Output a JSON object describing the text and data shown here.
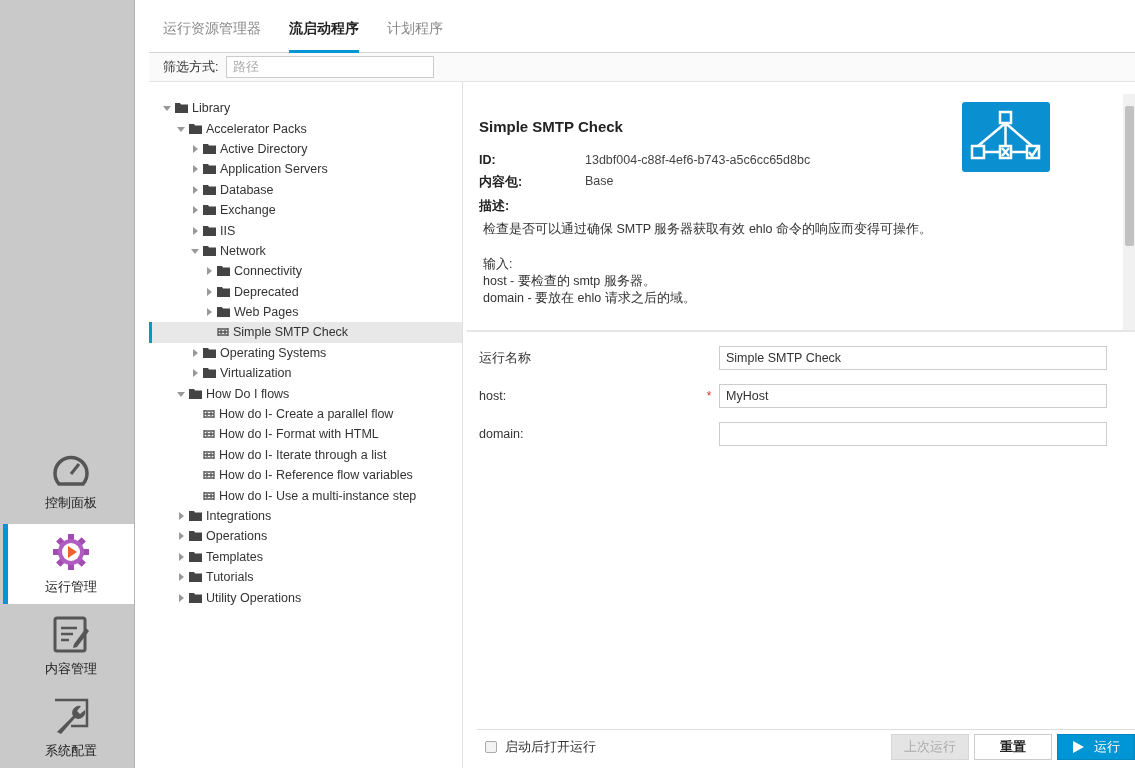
{
  "nav": [
    {
      "label": "控制面板",
      "selected": false
    },
    {
      "label": "运行管理",
      "selected": true
    },
    {
      "label": "内容管理",
      "selected": false
    },
    {
      "label": "系统配置",
      "selected": false
    }
  ],
  "tabs": [
    {
      "label": "运行资源管理器",
      "selected": false
    },
    {
      "label": "流启动程序",
      "selected": true
    },
    {
      "label": "计划程序",
      "selected": false
    }
  ],
  "filter": {
    "label": "筛选方式:",
    "placeholder": "路径"
  },
  "tree": [
    {
      "kind": "folder",
      "label": "Library",
      "expanded": true,
      "selected": false,
      "children": [
        {
          "kind": "folder",
          "label": "Accelerator Packs",
          "expanded": true,
          "selected": false,
          "children": [
            {
              "kind": "folder",
              "label": "Active Directory",
              "expanded": false,
              "selected": false
            },
            {
              "kind": "folder",
              "label": "Application Servers",
              "expanded": false,
              "selected": false
            },
            {
              "kind": "folder",
              "label": "Database",
              "expanded": false,
              "selected": false
            },
            {
              "kind": "folder",
              "label": "Exchange",
              "expanded": false,
              "selected": false
            },
            {
              "kind": "folder",
              "label": "IIS",
              "expanded": false,
              "selected": false
            },
            {
              "kind": "folder",
              "label": "Network",
              "expanded": true,
              "selected": false,
              "children": [
                {
                  "kind": "folder",
                  "label": "Connectivity",
                  "expanded": false,
                  "selected": false
                },
                {
                  "kind": "folder",
                  "label": "Deprecated",
                  "expanded": false,
                  "selected": false
                },
                {
                  "kind": "folder",
                  "label": "Web Pages",
                  "expanded": false,
                  "selected": false
                },
                {
                  "kind": "flow",
                  "label": "Simple SMTP Check",
                  "selected": true
                }
              ]
            },
            {
              "kind": "folder",
              "label": "Operating Systems",
              "expanded": false,
              "selected": false
            },
            {
              "kind": "folder",
              "label": "Virtualization",
              "expanded": false,
              "selected": false
            }
          ]
        },
        {
          "kind": "folder",
          "label": "How Do I flows",
          "expanded": true,
          "selected": false,
          "children": [
            {
              "kind": "flow",
              "label": "How do I- Create a parallel flow",
              "selected": false
            },
            {
              "kind": "flow",
              "label": "How do I- Format with HTML",
              "selected": false
            },
            {
              "kind": "flow",
              "label": "How do I- Iterate through a list",
              "selected": false
            },
            {
              "kind": "flow",
              "label": "How do I- Reference flow variables",
              "selected": false
            },
            {
              "kind": "flow",
              "label": "How do I- Use a multi-instance step",
              "selected": false
            }
          ]
        },
        {
          "kind": "folder",
          "label": "Integrations",
          "expanded": false,
          "selected": false
        },
        {
          "kind": "folder",
          "label": "Operations",
          "expanded": false,
          "selected": false
        },
        {
          "kind": "folder",
          "label": "Templates",
          "expanded": false,
          "selected": false
        },
        {
          "kind": "folder",
          "label": "Tutorials",
          "expanded": false,
          "selected": false
        },
        {
          "kind": "folder",
          "label": "Utility Operations",
          "expanded": false,
          "selected": false
        }
      ]
    }
  ],
  "details": {
    "title": "Simple SMTP Check",
    "fields": [
      {
        "label": "ID:",
        "value": "13dbf004-c88f-4ef6-b743-a5c6cc65d8bc"
      },
      {
        "label": "内容包:",
        "value": "Base"
      }
    ],
    "description_label": "描述:",
    "description_paragraphs": [
      [
        "检查是否可以通过确保 SMTP 服务器获取有效 ehlo 命令的响应而变得可操作。"
      ],
      [
        "输入:",
        "host - 要检查的 smtp 服务器。",
        "domain - 要放在 ehlo 请求之后的域。"
      ]
    ]
  },
  "run_form": {
    "fields": [
      {
        "label": "运行名称",
        "value": "Simple SMTP Check"
      },
      {
        "label": "host:",
        "value": "MyHost",
        "required_mark": "*"
      },
      {
        "label": "domain:"
      }
    ]
  },
  "footer": {
    "checkbox": {
      "label": "启动后打开运行",
      "checked": false
    },
    "buttons": [
      {
        "label": "上次运行",
        "kind": "secondary",
        "disabled": true
      },
      {
        "label": "重置",
        "kind": "secondary",
        "disabled": false
      },
      {
        "label": "运行",
        "kind": "primary",
        "disabled": false
      }
    ]
  }
}
